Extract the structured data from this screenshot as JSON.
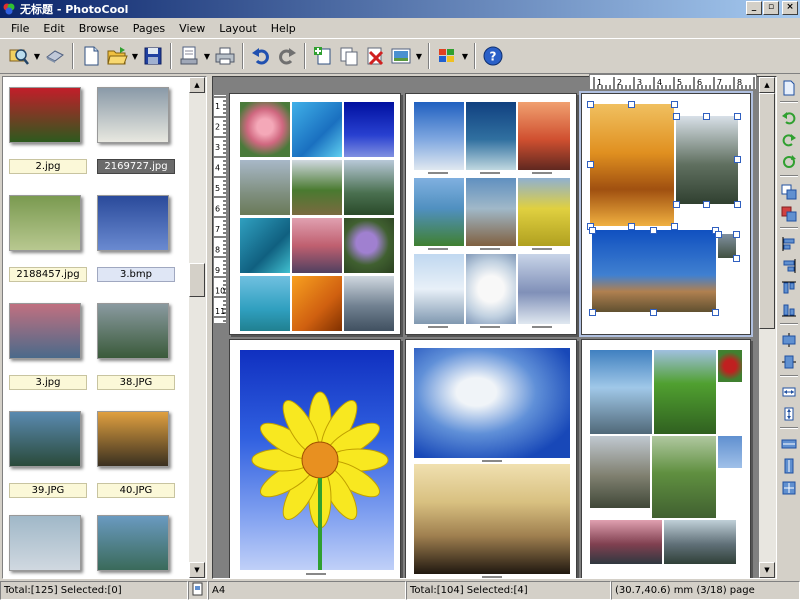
{
  "window": {
    "title": "无标题 - PhotoCool",
    "buttons": {
      "minimize": "_",
      "maximize": "▫",
      "close": "×"
    }
  },
  "menu": [
    "File",
    "Edit",
    "Browse",
    "Pages",
    "View",
    "Layout",
    "Help"
  ],
  "toolbar": {
    "buttons": [
      "browse-folder",
      "scan",
      "new-page",
      "open",
      "save",
      "print-preview",
      "print",
      "undo",
      "redo",
      "add-page",
      "duplicate-page",
      "delete-page",
      "page-layout",
      "windows",
      "help"
    ]
  },
  "thumbnails": [
    {
      "label": "2.jpg",
      "state": "normal",
      "colors": [
        "#c21e2a",
        "#2d5a1e"
      ]
    },
    {
      "label": "2169727.jpg",
      "state": "selected",
      "colors": [
        "#8a9aa8",
        "#e8e8e0"
      ]
    },
    {
      "label": "2188457.jpg",
      "state": "normal",
      "colors": [
        "#7a9a50",
        "#b8c890"
      ]
    },
    {
      "label": "3.bmp",
      "state": "hilite",
      "colors": [
        "#2a4a9a",
        "#6a8ad0"
      ]
    },
    {
      "label": "3.jpg",
      "state": "normal",
      "colors": [
        "#c07080",
        "#4a6a8a"
      ]
    },
    {
      "label": "38.JPG",
      "state": "normal",
      "colors": [
        "#8a9aa0",
        "#3a5a3a"
      ]
    },
    {
      "label": "39.JPG",
      "state": "normal",
      "colors": [
        "#5a8ab0",
        "#2a4a3a"
      ]
    },
    {
      "label": "40.JPG",
      "state": "normal",
      "colors": [
        "#e0a040",
        "#3a3020"
      ]
    },
    {
      "label": "",
      "state": "normal",
      "colors": [
        "#a0b8c8",
        "#d0d8e0"
      ]
    },
    {
      "label": "",
      "state": "normal",
      "colors": [
        "#6a9ac0",
        "#3a6a5a"
      ]
    }
  ],
  "hruler_labels": [
    "1",
    "2",
    "3",
    "4",
    "5",
    "6",
    "7",
    "8"
  ],
  "vruler_labels": [
    "1",
    "2",
    "3",
    "4",
    "5",
    "6",
    "7",
    "8",
    "9",
    "10",
    "11"
  ],
  "colors": {
    "accent": "#0a246a",
    "selection_handle": "#3060c0",
    "workarea": "#808080"
  },
  "status": {
    "total": "Total:[125] Selected:[0]",
    "paper": "A4",
    "page_total": "Total:[104] Selected:[4]",
    "coords": "(30.7,40.6) mm (3/18) page"
  }
}
